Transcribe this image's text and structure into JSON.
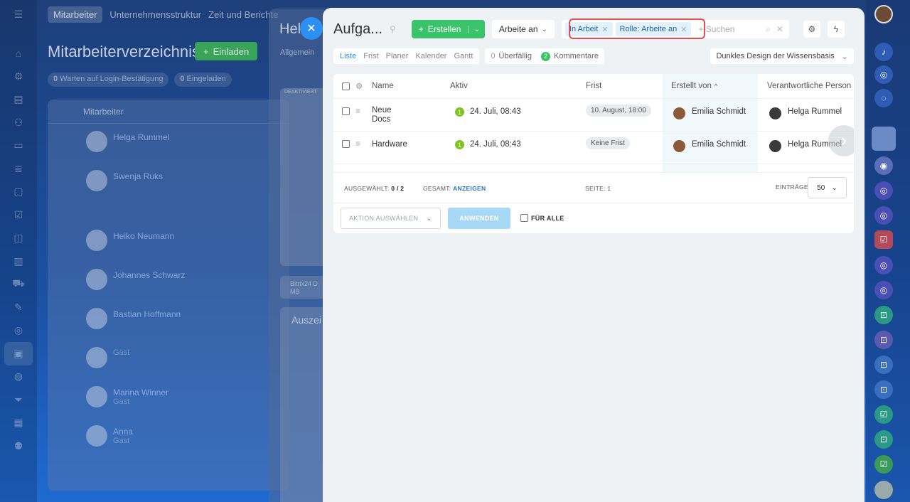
{
  "left_sidebar": {
    "icons": [
      "menu-icon",
      "home-icon",
      "settings-icon",
      "document-icon",
      "users-icon",
      "file-icon",
      "stack-icon",
      "chat-icon",
      "check-icon",
      "tasks-icon",
      "chart-icon",
      "cart-icon",
      "edit-icon",
      "database-icon",
      "contacts-icon",
      "globe-icon",
      "filter-icon",
      "calendar-icon",
      "group-icon",
      "more-icon"
    ]
  },
  "background": {
    "nav": [
      "Mitarbeiter",
      "Unternehmensstruktur",
      "Zeit und Berichte"
    ],
    "title": "Mitarbeiterverzeichnis",
    "invite_label": "Einladen",
    "counters": [
      {
        "num": "0",
        "label": "Warten auf Login-Bestätigung"
      },
      {
        "num": "0",
        "label": "Eingeladen"
      }
    ],
    "table_header": "Mitarbeiter",
    "employees": [
      {
        "name": "Helga Rummel",
        "sub": ""
      },
      {
        "name": "Swenja Ruks",
        "sub": ""
      },
      {
        "name": "Heiko Neumann",
        "sub": ""
      },
      {
        "name": "Johannes Schwarz",
        "sub": ""
      },
      {
        "name": "Bastian Hoffmann",
        "sub": ""
      },
      {
        "name": "",
        "sub": "Gast"
      },
      {
        "name": "Marina Winner",
        "sub": "Gast"
      },
      {
        "name": "Anna",
        "sub": "Gast"
      }
    ],
    "panel2_title": "Hel",
    "panel2_tab": "Allgemein",
    "panel2_deact": "DEAKTIVIERT",
    "panel2_section": "Auszei",
    "panel2_small": "Bitrix24 D MB"
  },
  "slider": {
    "title": "Aufga...",
    "create_label": "Erstellen",
    "role_select": "Arbeite an",
    "filter_chips": [
      "In Arbeit",
      "Rolle: Arbeite an"
    ],
    "search_placeholder": "+ Suchen",
    "view_tabs": [
      "Liste",
      "Frist",
      "Planer",
      "Kalender",
      "Gantt"
    ],
    "active_view": "Liste",
    "overdue": {
      "count": "0",
      "label": "Überfällig"
    },
    "comments": {
      "count": "2",
      "label": "Kommentare"
    },
    "theme_select": "Dunkles Design der Wissensbasis",
    "columns": [
      "Name",
      "Aktiv",
      "Frist",
      "Erstellt von",
      "Verantwortliche Person"
    ],
    "tasks": [
      {
        "name": "Neue Docs",
        "active_count": "1",
        "active": "24. Juli, 08:43",
        "deadline": "10. August, 18:00",
        "created_by": "Emilia Schmidt",
        "responsible": "Helga Rummel"
      },
      {
        "name": "Hardware",
        "active_count": "1",
        "active": "24. Juli, 08:43",
        "deadline": "Keine Frist",
        "created_by": "Emilia Schmidt",
        "responsible": "Helga Rummel"
      }
    ],
    "footer": {
      "selected_label": "AUSGEWÄHLT:",
      "selected_value": "0 / 2",
      "total_label": "GESAMT:",
      "total_link": "ANZEIGEN",
      "page_label": "SEITE:",
      "page_value": "1",
      "entries_label": "EINTRÄGE",
      "entries_value": "50",
      "action_placeholder": "AKTION AUSWÄHLEN",
      "apply_label": "ANWENDEN",
      "for_all_label": "FÜR ALLE"
    }
  },
  "colors": {
    "accent": "#2b8ff3",
    "create_green": "#3bc36b",
    "highlight_red": "#e05050",
    "badge_green": "#7cc51e"
  }
}
